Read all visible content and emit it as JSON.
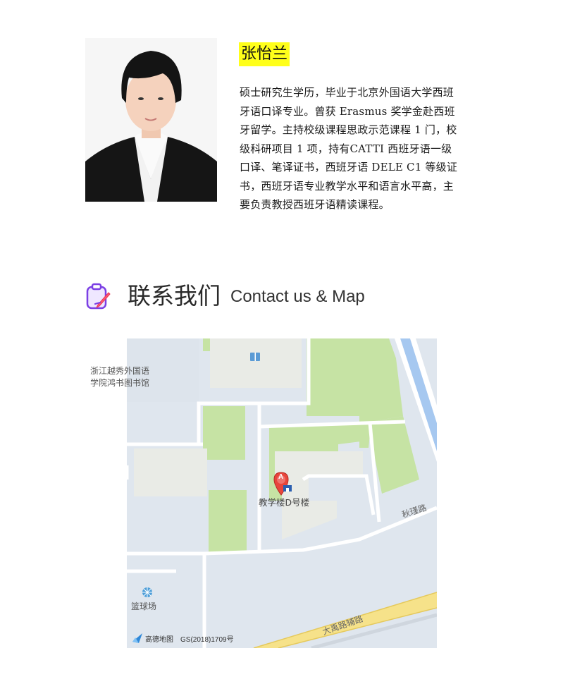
{
  "profile": {
    "name": "张怡兰",
    "bio_lines": [
      "硕士研究生学历，毕业于北京外国语大学西班",
      "牙语口译专业。曾获 Erasmus 奖学金赴西班",
      "牙留学。主持校级课程思政示范课程 1 门，校",
      "级科研项目 1 项，持有CATTI 西班牙语一级",
      "口译、笔译证书，西班牙语 DELE C1 等级证",
      "书，西班牙语专业教学水平和语言水平高，主",
      "要负责教授西班牙语精读课程。"
    ],
    "highlight_color": "#ffff1a"
  },
  "contact": {
    "title_cn": "联系我们",
    "title_en": "Contact us & Map",
    "icon": "clipboard-pen-icon",
    "icon_color": "#7b3fe4"
  },
  "map": {
    "labels": {
      "library_line1": "浙江越秀外国语",
      "library_line2": "学院鸿书图书馆",
      "teaching_building": "教学楼D号楼",
      "road_qiujin": "秋瑾路",
      "road_dayu": "大禹路辅路",
      "basketball_court": "篮球场"
    },
    "marker_letter": "A",
    "brand": "高德地图",
    "approval_number": "GS(2018)1709号",
    "icons": [
      "library-icon",
      "map-marker-icon",
      "building-icon",
      "basketball-icon",
      "amap-logo-icon"
    ],
    "colors": {
      "background": "#dfe6ee",
      "green": "#c6e3a4",
      "building": "#e9ebe6",
      "road": "#ffffff",
      "water": "#a6c8f0",
      "highway": "#f6e28a",
      "marker": "#e8453c"
    }
  }
}
